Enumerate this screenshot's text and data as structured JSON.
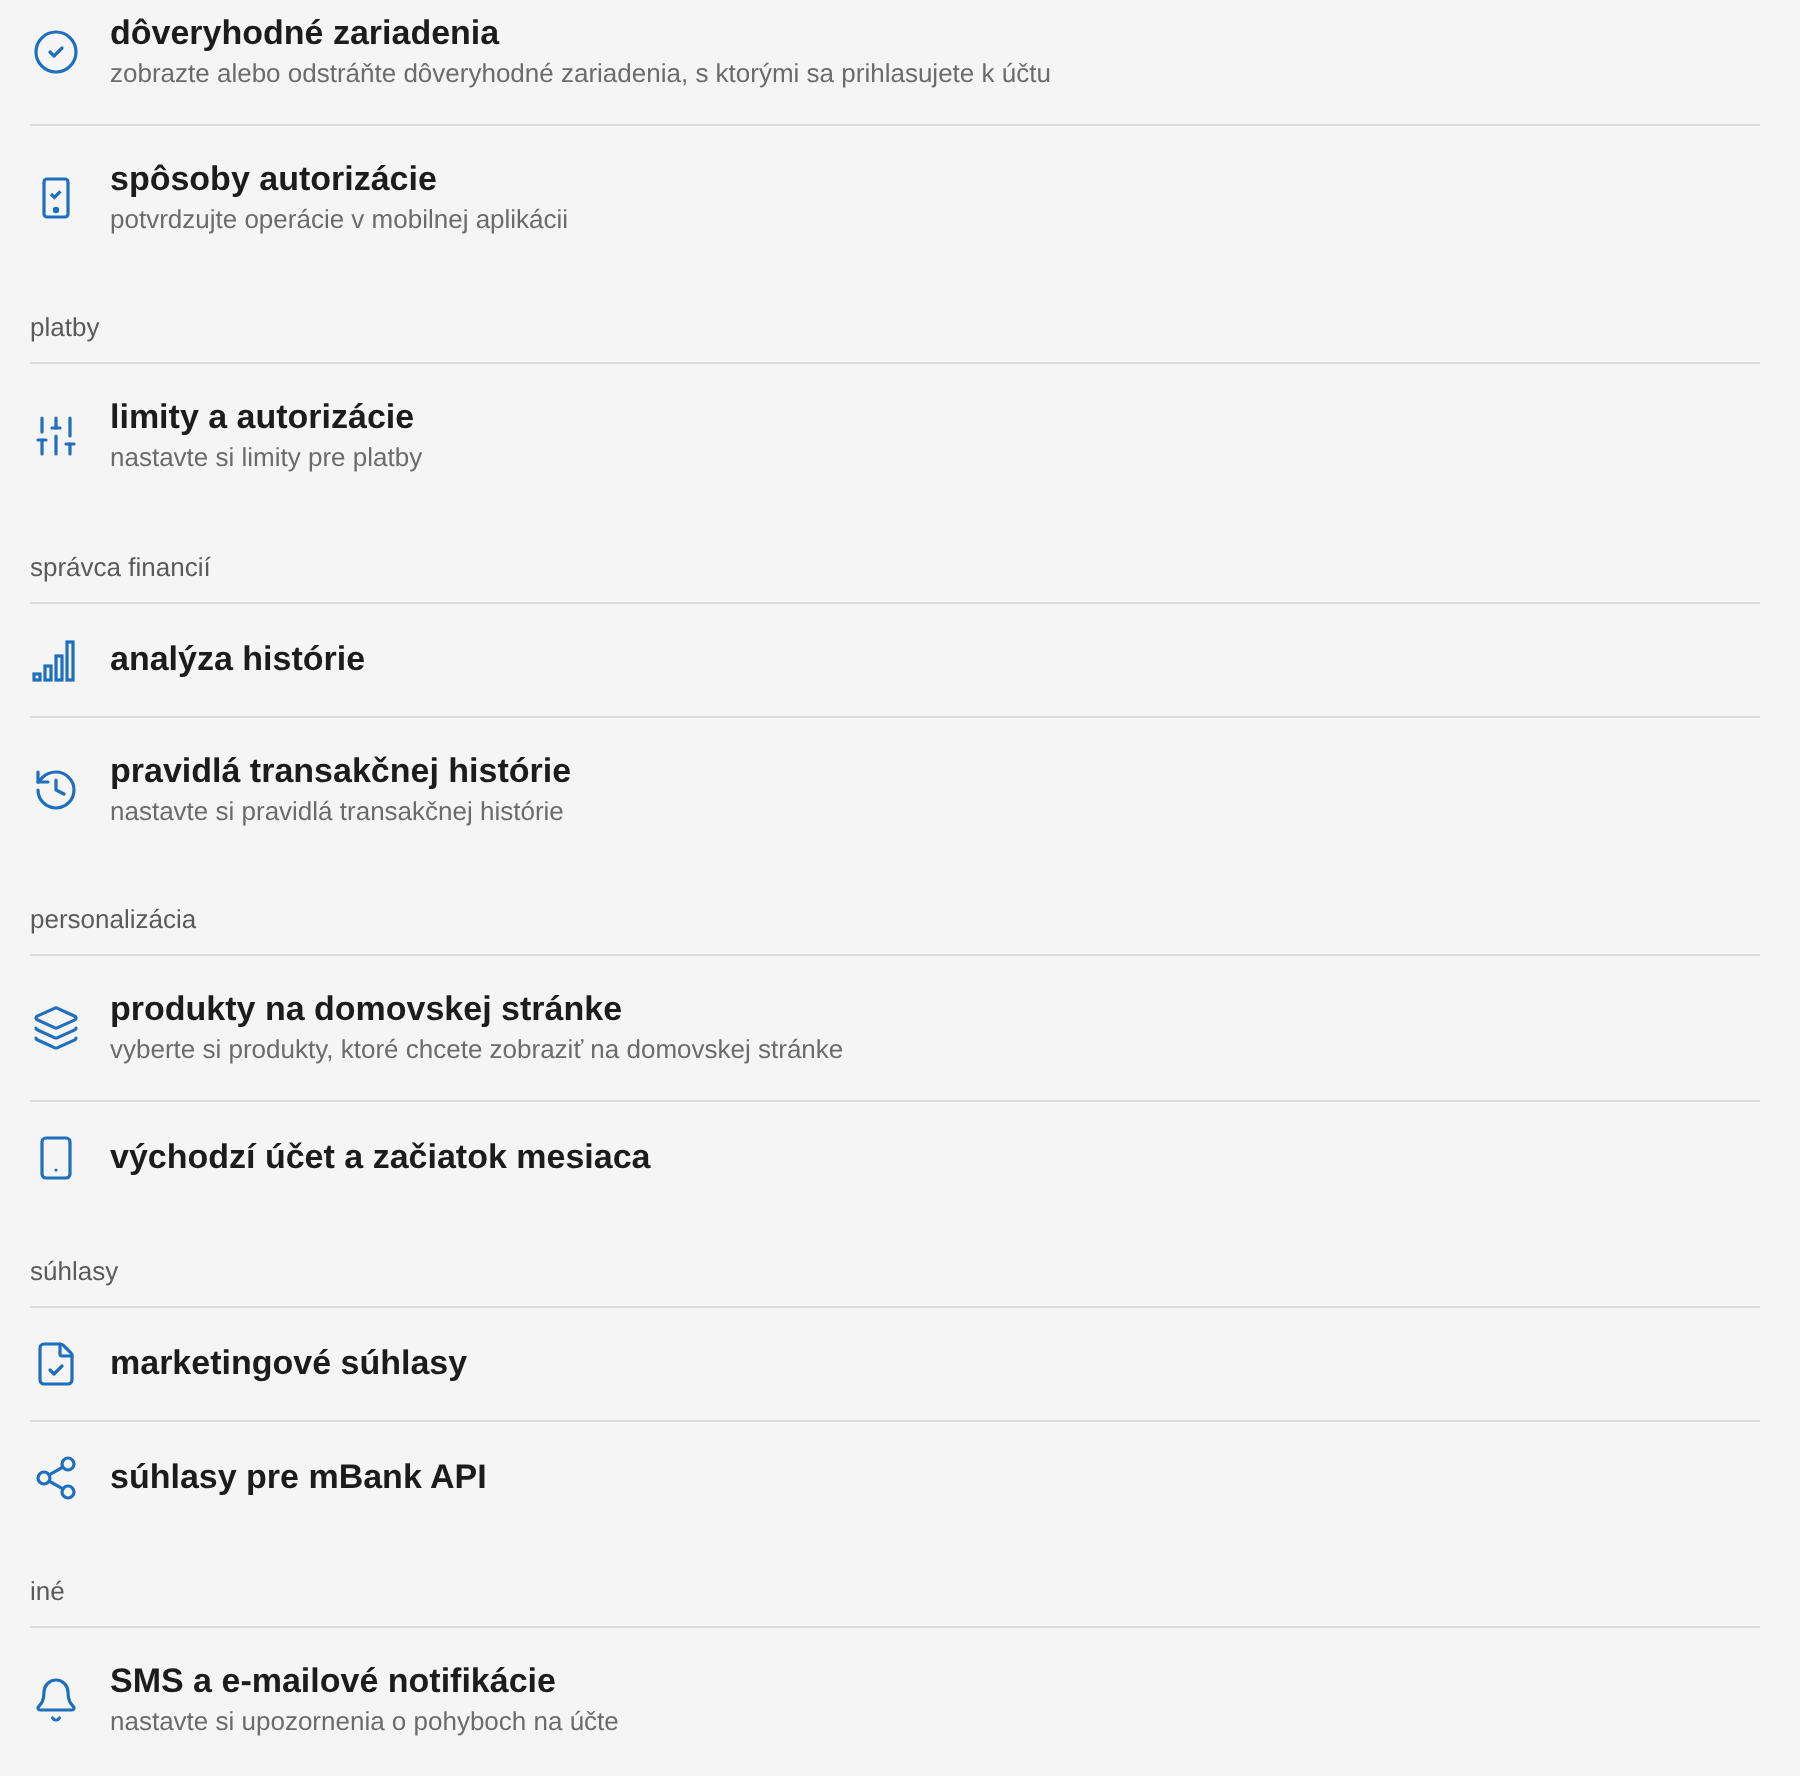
{
  "sections": [
    {
      "items": [
        {
          "title": "dôveryhodné zariadenia",
          "subtitle": "zobrazte alebo odstráňte dôveryhodné zariadenia, s ktorými sa prihlasujete k účtu"
        },
        {
          "title": "spôsoby autorizácie",
          "subtitle": "potvrdzujte operácie v mobilnej aplikácii"
        }
      ]
    },
    {
      "heading": "platby",
      "items": [
        {
          "title": "limity a autorizácie",
          "subtitle": "nastavte si limity pre platby"
        }
      ]
    },
    {
      "heading": "správca financií",
      "items": [
        {
          "title": "analýza histórie"
        },
        {
          "title": "pravidlá transakčnej histórie",
          "subtitle": "nastavte si pravidlá transakčnej histórie"
        }
      ]
    },
    {
      "heading": "personalizácia",
      "items": [
        {
          "title": "produkty na domovskej stránke",
          "subtitle": "vyberte si produkty, ktoré chcete zobraziť na domovskej stránke"
        },
        {
          "title": "východzí účet a začiatok mesiaca"
        }
      ]
    },
    {
      "heading": "súhlasy",
      "items": [
        {
          "title": "marketingové súhlasy"
        },
        {
          "title": "súhlasy pre mBank API"
        }
      ]
    },
    {
      "heading": "iné",
      "items": [
        {
          "title": "SMS a e-mailové notifikácie",
          "subtitle": "nastavte si upozornenia o pohyboch na účte"
        }
      ]
    }
  ]
}
